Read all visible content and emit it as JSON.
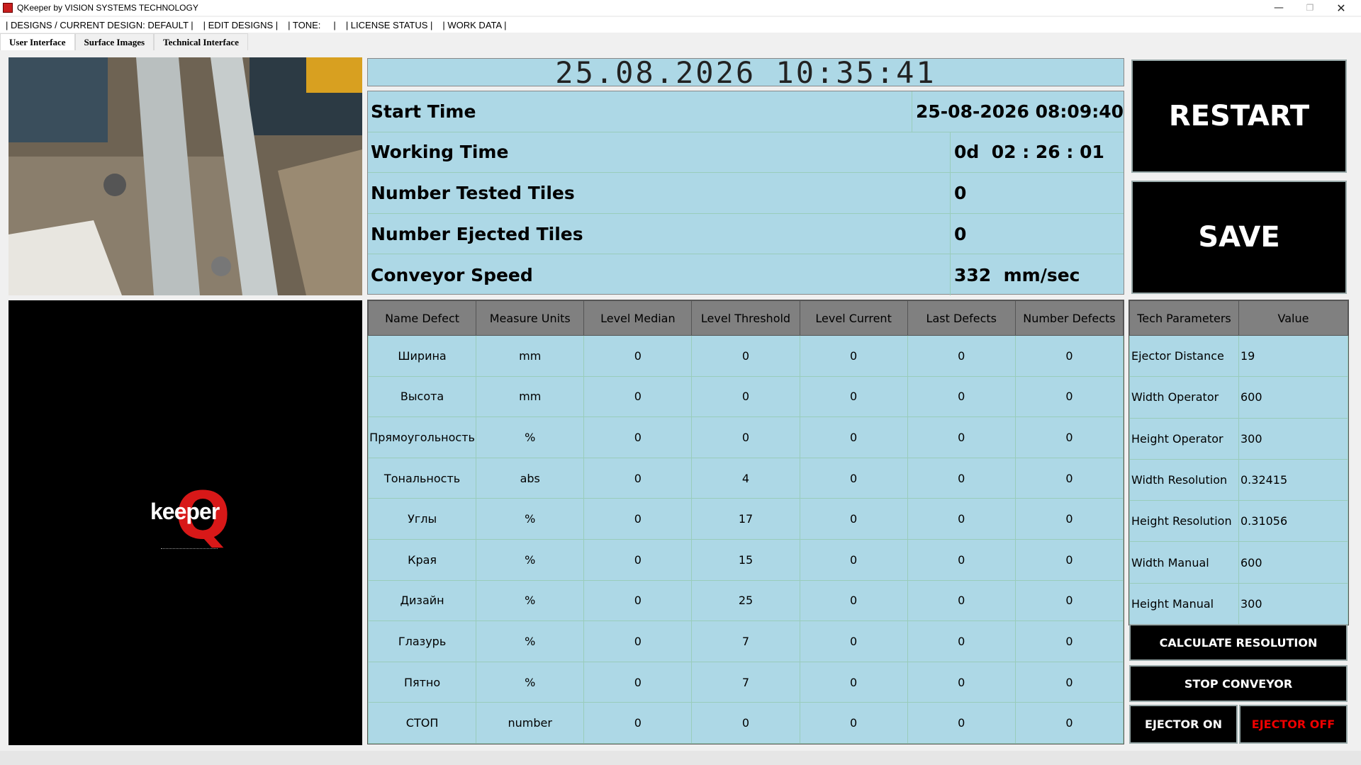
{
  "window": {
    "title": "QKeeper by VISION SYSTEMS TECHNOLOGY",
    "min": "—",
    "max": "❐",
    "close": "✕"
  },
  "menu": [
    "| DESIGNS / CURRENT DESIGN: DEFAULT |",
    "| EDIT DESIGNS |",
    "| TONE:     |",
    "| LICENSE STATUS |",
    "| WORK DATA |"
  ],
  "tabs": [
    "User Interface",
    "Surface Images",
    "Technical Interface"
  ],
  "clock": "25.08.2026  10:35:41",
  "status": [
    {
      "label": "Start Time",
      "value": "25-08-2026 08:09:40"
    },
    {
      "label": "Working Time",
      "value": "0d  02 : 26 : 01"
    },
    {
      "label": "Number Tested Tiles",
      "value": "0"
    },
    {
      "label": "Number Ejected Tiles",
      "value": "0"
    },
    {
      "label": "Conveyor Speed",
      "value": "332  mm/sec"
    }
  ],
  "buttons": {
    "restart": "RESTART",
    "save": "SAVE",
    "calc": "CALCULATE RESOLUTION",
    "stop": "STOP CONVEYOR",
    "ejector_on": "EJECTOR ON",
    "ejector_off": "EJECTOR OFF"
  },
  "defects": {
    "headers": [
      "Name Defect",
      "Measure Units",
      "Level Median",
      "Level Threshold",
      "Level Current",
      "Last Defects",
      "Number Defects"
    ],
    "rows": [
      [
        "Ширина",
        "mm",
        "0",
        "0",
        "0",
        "0",
        "0"
      ],
      [
        "Высота",
        "mm",
        "0",
        "0",
        "0",
        "0",
        "0"
      ],
      [
        "Прямоугольность",
        "%",
        "0",
        "0",
        "0",
        "0",
        "0"
      ],
      [
        "Тональность",
        "abs",
        "0",
        "4",
        "0",
        "0",
        "0"
      ],
      [
        "Углы",
        "%",
        "0",
        "17",
        "0",
        "0",
        "0"
      ],
      [
        "Края",
        "%",
        "0",
        "15",
        "0",
        "0",
        "0"
      ],
      [
        "Дизайн",
        "%",
        "0",
        "25",
        "0",
        "0",
        "0"
      ],
      [
        "Глазурь",
        "%",
        "0",
        "7",
        "0",
        "0",
        "0"
      ],
      [
        "Пятно",
        "%",
        "0",
        "7",
        "0",
        "0",
        "0"
      ],
      [
        "СТОП",
        "number",
        "0",
        "0",
        "0",
        "0",
        "0"
      ]
    ]
  },
  "tech": {
    "headers": [
      "Tech Parameters",
      "Value"
    ],
    "rows": [
      [
        "Ejector Distance",
        "19"
      ],
      [
        "Width Operator",
        "600"
      ],
      [
        "Height Operator",
        "300"
      ],
      [
        "Width Resolution",
        "0.32415"
      ],
      [
        "Height Resolution",
        "0.31056"
      ],
      [
        "Width Manual",
        "600"
      ],
      [
        "Height Manual",
        "300"
      ]
    ]
  },
  "logo": {
    "q": "Q",
    "text": "keeper"
  }
}
